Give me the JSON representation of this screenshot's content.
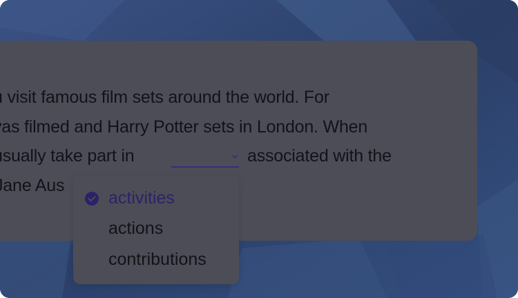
{
  "passage": {
    "line1": "u visit famous film sets around the world. For",
    "line2": "vas filmed and Harry Potter sets in London. When",
    "line3_before": "usually take part in",
    "line3_after": "associated with the",
    "line4": "Jane Aus"
  },
  "dropdown": {
    "selected_value": "",
    "options": [
      {
        "label": "activities",
        "selected": true
      },
      {
        "label": "actions",
        "selected": false
      },
      {
        "label": "contributions",
        "selected": false
      }
    ]
  },
  "colors": {
    "accent": "#3b2c7a",
    "selected_text": "#2c2267",
    "overlay_card": "#4d4d57",
    "background": "#2e436e"
  },
  "icons": {
    "chevron": "chevron-down-icon",
    "check": "check-circle-icon"
  }
}
